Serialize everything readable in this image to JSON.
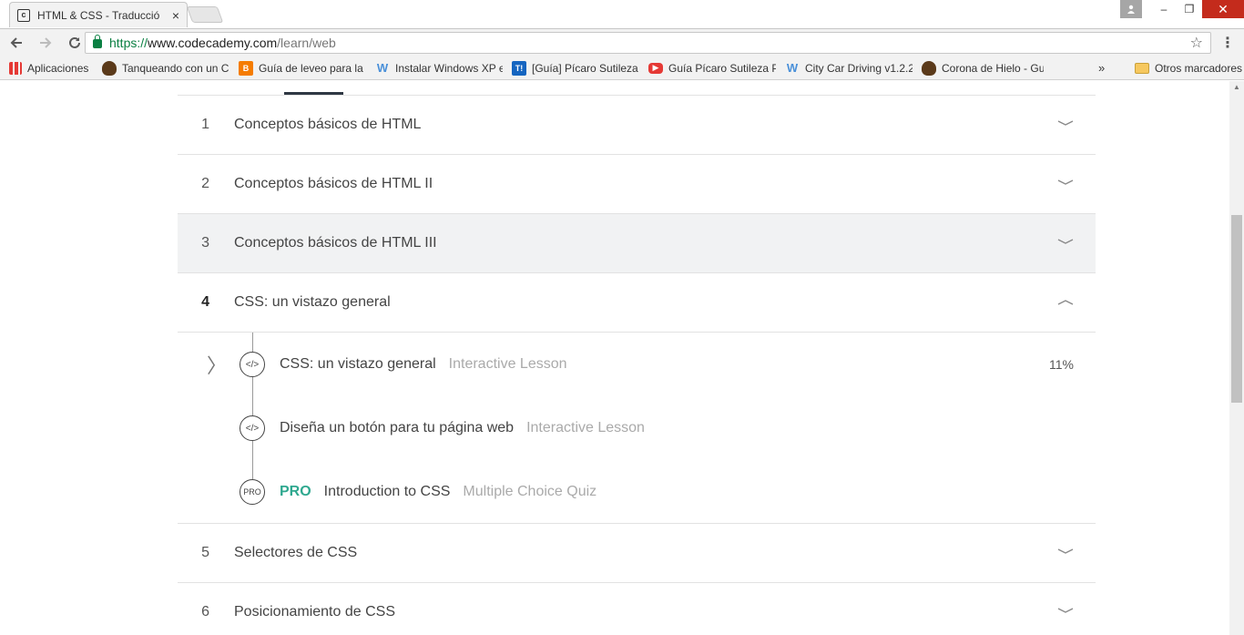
{
  "browser": {
    "tab_title": "HTML & CSS - Traducció",
    "tab_close": "×",
    "window": {
      "min": "–",
      "max": "❐",
      "close": "✕"
    },
    "url_scheme": "https://",
    "url_host": "www.codecademy.com",
    "url_path": "/learn/web",
    "bookmarks": [
      {
        "label": "Aplicaciones",
        "icon": "apps-grid-icon"
      },
      {
        "label": "Tanqueando con un C",
        "icon": "shield-icon"
      },
      {
        "label": "Guía de leveo para la",
        "icon": "blogger-icon"
      },
      {
        "label": "Instalar Windows XP e",
        "icon": "w-icon"
      },
      {
        "label": "[Guía] Pícaro Sutileza",
        "icon": "taringa-icon"
      },
      {
        "label": "Guía Pícaro Sutileza P",
        "icon": "youtube-icon"
      },
      {
        "label": "City Car Driving v1.2.2",
        "icon": "w-icon"
      },
      {
        "label": "Corona de Hielo - Gui",
        "icon": "shield-icon"
      }
    ],
    "bookmarks_more": "»",
    "other_bookmarks": "Otros marcadores"
  },
  "course": {
    "units_before": [
      {
        "num": "1",
        "title": "Conceptos básicos de HTML"
      },
      {
        "num": "2",
        "title": "Conceptos básicos de HTML II"
      },
      {
        "num": "3",
        "title": "Conceptos básicos de HTML III"
      }
    ],
    "active_unit": {
      "num": "4",
      "title": "CSS: un vistazo general"
    },
    "lessons": [
      {
        "title": "CSS: un vistazo general",
        "type": "Interactive Lesson",
        "progress": "11%",
        "badge": "</>"
      },
      {
        "title": "Diseña un botón para tu página web",
        "type": "Interactive Lesson",
        "badge": "</>"
      },
      {
        "pro": "PRO",
        "title": "Introduction to CSS",
        "type": "Multiple Choice Quiz",
        "badge": "PRO"
      }
    ],
    "units_after": [
      {
        "num": "5",
        "title": "Selectores de CSS"
      },
      {
        "num": "6",
        "title": "Posicionamiento de CSS"
      }
    ]
  }
}
